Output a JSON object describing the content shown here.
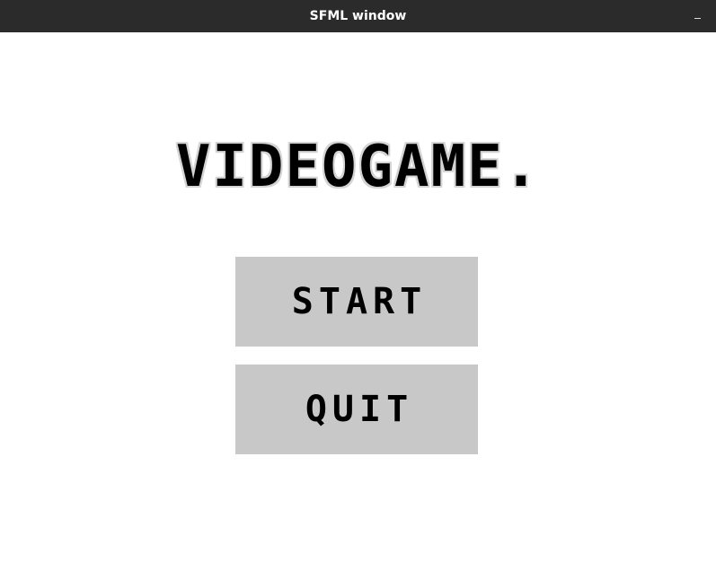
{
  "window": {
    "title": "SFML window",
    "minimize_glyph": "–"
  },
  "game": {
    "title": "VIDEOGAME."
  },
  "menu": {
    "start_label": "START",
    "quit_label": "QUIT"
  },
  "colors": {
    "titlebar_bg": "#2b2b2b",
    "canvas_bg": "#ffffff",
    "button_bg": "#c8c8c8",
    "text": "#000000",
    "title_outline": "#d4d4d4"
  }
}
